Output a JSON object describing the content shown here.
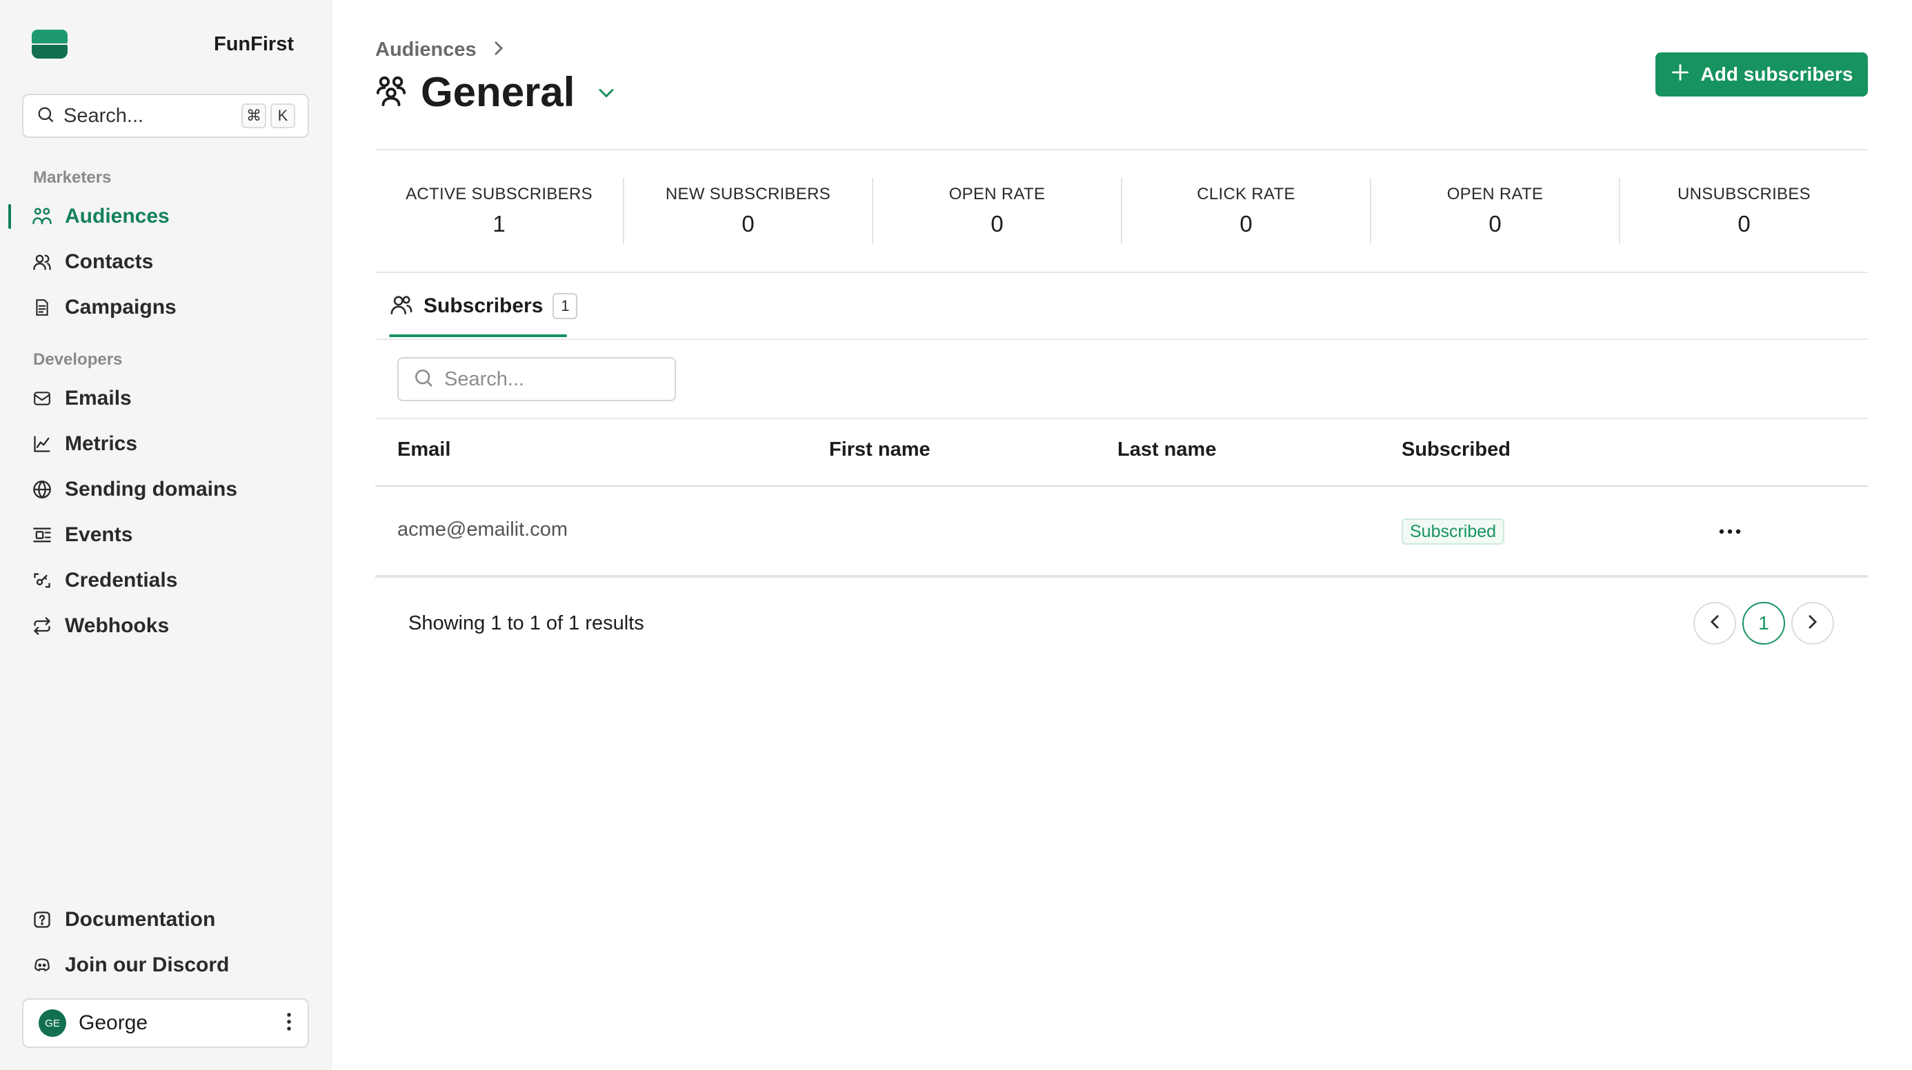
{
  "app": {
    "name": "FunFirst"
  },
  "sidebar": {
    "search": {
      "placeholder": "Search...",
      "shortcut": [
        "⌘",
        "K"
      ]
    },
    "sections": [
      {
        "label": "Marketers",
        "items": [
          {
            "label": "Audiences",
            "icon": "users-icon",
            "active": true
          },
          {
            "label": "Contacts",
            "icon": "contacts-icon"
          },
          {
            "label": "Campaigns",
            "icon": "document-icon"
          }
        ]
      },
      {
        "label": "Developers",
        "items": [
          {
            "label": "Emails",
            "icon": "mail-icon"
          },
          {
            "label": "Metrics",
            "icon": "chart-icon"
          },
          {
            "label": "Sending domains",
            "icon": "globe-icon"
          },
          {
            "label": "Events",
            "icon": "events-icon"
          },
          {
            "label": "Credentials",
            "icon": "key-icon"
          },
          {
            "label": "Webhooks",
            "icon": "repeat-icon"
          }
        ]
      }
    ],
    "bottom": [
      {
        "label": "Documentation",
        "icon": "help-icon"
      },
      {
        "label": "Join our Discord",
        "icon": "discord-icon"
      }
    ],
    "user": {
      "initials": "GE",
      "name": "George"
    }
  },
  "header": {
    "breadcrumb": "Audiences",
    "title": "General",
    "add_button": "Add subscribers"
  },
  "stats": [
    {
      "label": "ACTIVE SUBSCRIBERS",
      "value": "1"
    },
    {
      "label": "NEW SUBSCRIBERS",
      "value": "0"
    },
    {
      "label": "OPEN RATE",
      "value": "0"
    },
    {
      "label": "CLICK RATE",
      "value": "0"
    },
    {
      "label": "OPEN RATE",
      "value": "0"
    },
    {
      "label": "UNSUBSCRIBES",
      "value": "0"
    }
  ],
  "tab": {
    "label": "Subscribers",
    "count": "1"
  },
  "table": {
    "search_placeholder": "Search...",
    "columns": [
      "Email",
      "First name",
      "Last name",
      "Subscribed"
    ],
    "rows": [
      {
        "email": "acme@emailit.com",
        "first_name": "",
        "last_name": "",
        "status": "Subscribed"
      }
    ]
  },
  "pagination": {
    "summary": "Showing 1 to 1 of 1 results",
    "current_page": "1"
  },
  "colors": {
    "accent": "#17935f",
    "accent_dark": "#12704f",
    "sidebar_bg": "#f5f5f4"
  }
}
